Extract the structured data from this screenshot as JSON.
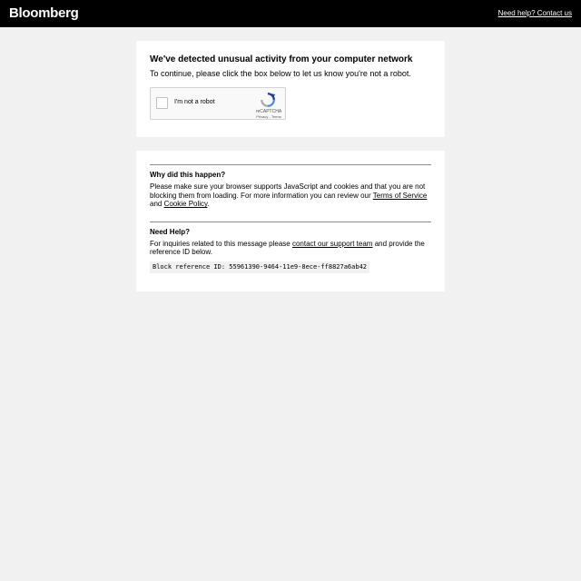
{
  "header": {
    "logo": "Bloomberg",
    "help_link": "Need help? Contact us"
  },
  "captcha_card": {
    "heading": "We've detected unusual activity from your computer network",
    "subtext": "To continue, please click the box below to let us know you're not a robot.",
    "recaptcha": {
      "checkbox_label": "I'm not a robot",
      "brand": "reCAPTCHA",
      "privacy": "Privacy",
      "separator": " - ",
      "terms": "Terms"
    }
  },
  "info_card": {
    "why": {
      "title": "Why did this happen?",
      "text_before": "Please make sure your browser supports JavaScript and cookies and that you are not blocking them from loading. For more information you can review our ",
      "terms_link": "Terms of Service",
      "text_and": " and ",
      "cookie_link": "Cookie Policy",
      "text_after": "."
    },
    "help": {
      "title": "Need Help?",
      "text_before": "For inquiries related to this message please ",
      "support_link": "contact our support team",
      "text_after": " and provide the reference ID below.",
      "reference_id": "Block reference ID: 55961390-9464-11e9-8ece-ff8827a6ab42"
    }
  },
  "colors": {
    "topbar": "#000000",
    "page_background": "#f1f1f1",
    "card_background": "#ffffff",
    "recaptcha_blue": "#4a90e2"
  }
}
